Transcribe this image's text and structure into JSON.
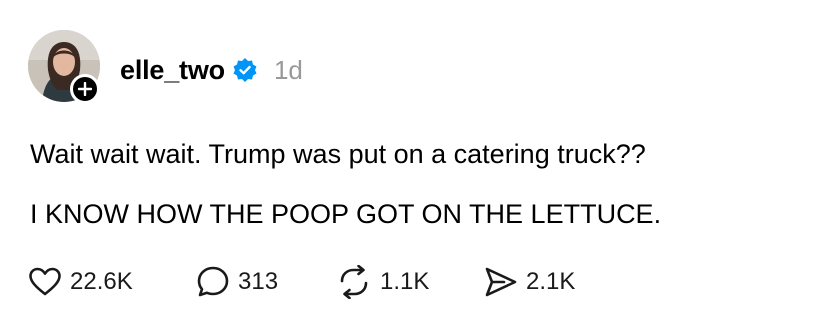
{
  "post": {
    "username": "elle_two",
    "time": "1d",
    "lines": [
      "Wait wait wait. Trump was put on a catering truck??",
      "I KNOW HOW THE POOP GOT ON THE LETTUCE."
    ]
  },
  "actions": {
    "likes": "22.6K",
    "replies": "313",
    "reposts": "1.1K",
    "shares": "2.1K"
  },
  "icons": {
    "avatar": "avatar",
    "follow": "plus-icon",
    "verified": "verified-badge-icon",
    "like": "heart-icon",
    "reply": "speech-bubble-icon",
    "repost": "repost-icon",
    "share": "send-icon"
  },
  "colors": {
    "verified": "#0095f6",
    "muted": "#999999",
    "text": "#000000"
  }
}
